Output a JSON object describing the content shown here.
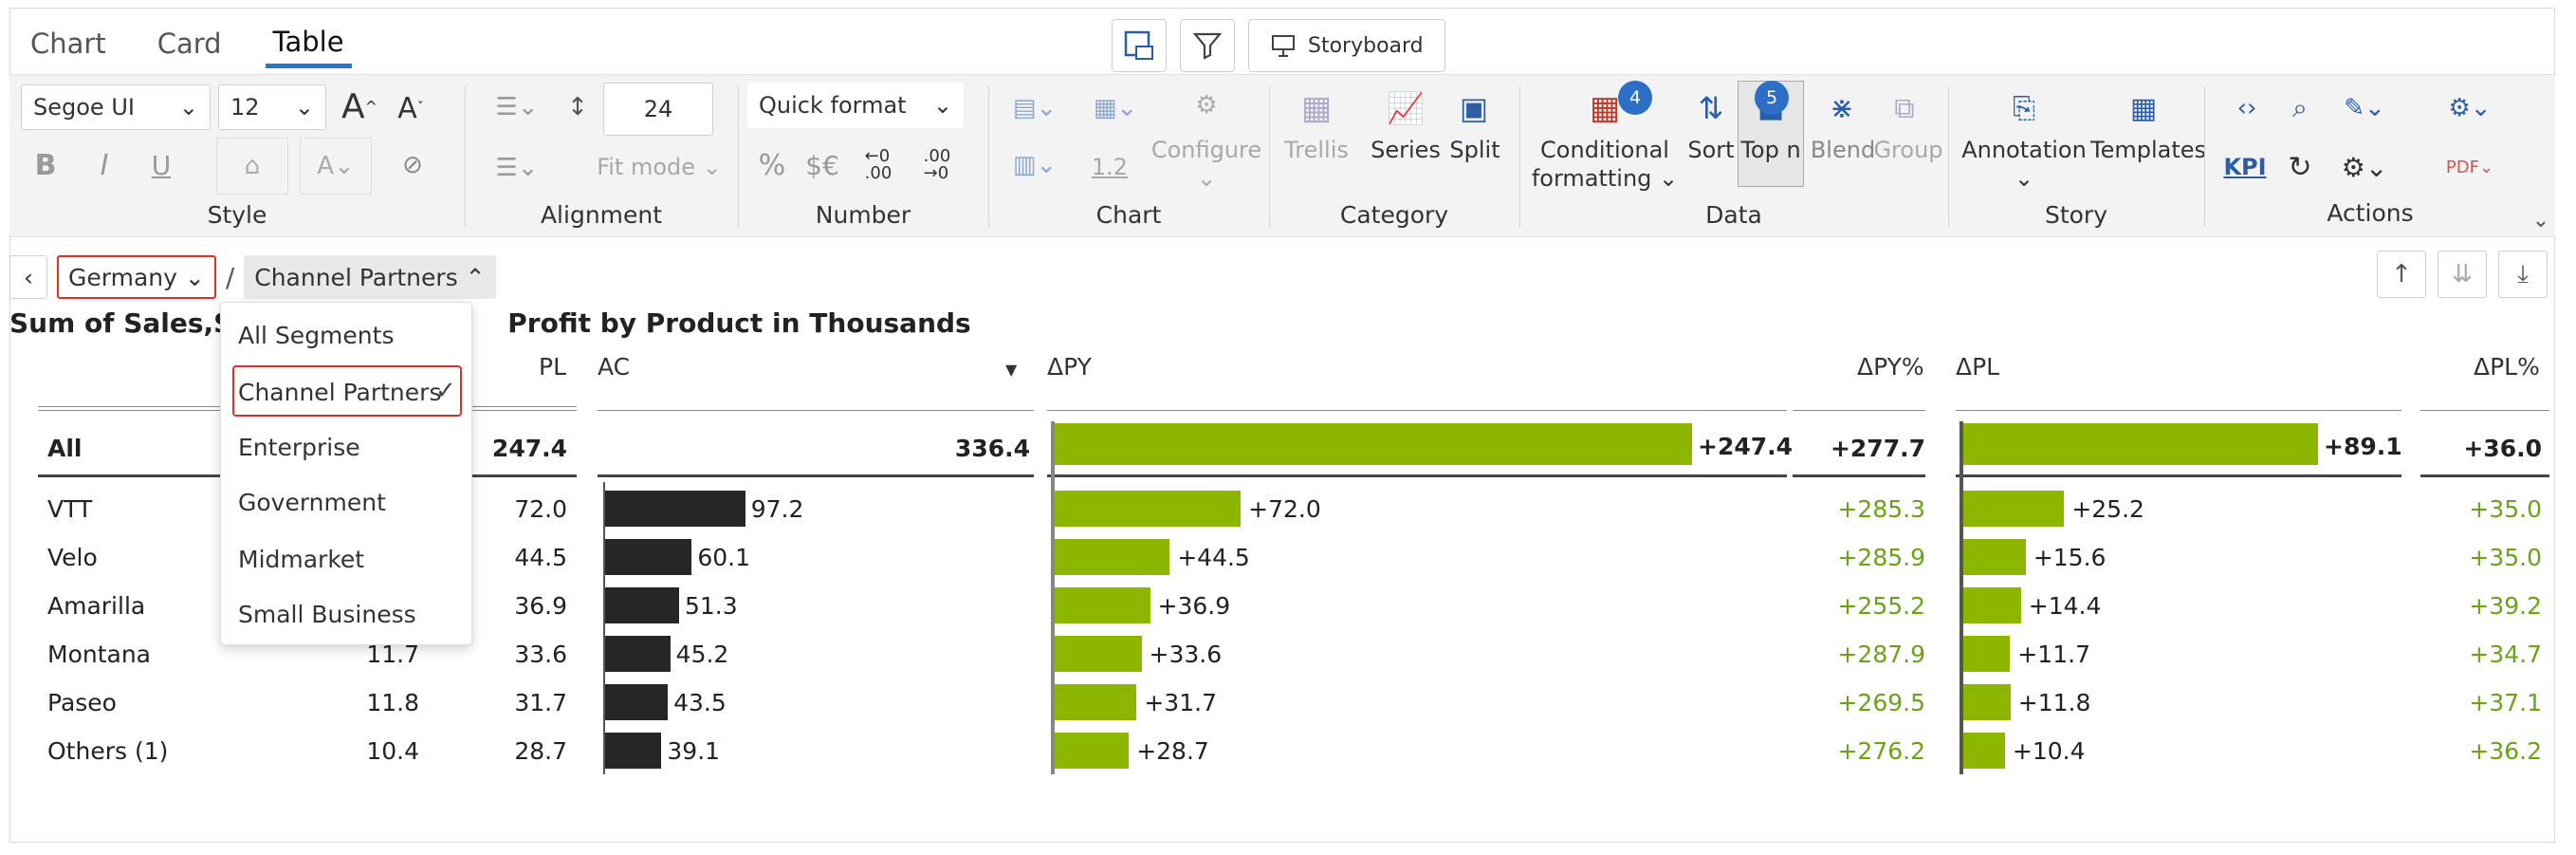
{
  "tabs": [
    {
      "label": "Chart"
    },
    {
      "label": "Card"
    },
    {
      "label": "Table"
    }
  ],
  "storyboard_label": "Storyboard",
  "ribbon": {
    "style": {
      "label": "Style",
      "font": "Segoe UI",
      "size": "12"
    },
    "alignment": {
      "label": "Alignment",
      "row_height": "24",
      "fit_mode": "Fit mode"
    },
    "number": {
      "label": "Number",
      "quick_format": "Quick format",
      "decimal": "1.2"
    },
    "chart": {
      "label": "Chart",
      "configure": "Configure"
    },
    "category": {
      "label": "Category",
      "trellis": "Trellis",
      "series": "Series",
      "split": "Split"
    },
    "data": {
      "label": "Data",
      "conditional_formatting_1": "Conditional",
      "conditional_formatting_2": "formatting",
      "cf_badge": "4",
      "sort": "Sort",
      "topn": "Top n",
      "topn_badge": "5",
      "blend": "Blend",
      "group": "Group"
    },
    "story": {
      "label": "Story",
      "annotation": "Annotation",
      "templates": "Templates"
    },
    "actions": {
      "label": "Actions",
      "kpi": "KPI"
    }
  },
  "breadcrumb": {
    "country": "Germany",
    "separator": "/",
    "segment": "Channel Partners"
  },
  "title": "Sum of Sales,Sum of Sales,Sum of Profit by Product in Thousands",
  "title_visible_left": "Sum of Sales,Su",
  "title_visible_right": "Profit by Product in Thousands",
  "dropdown": {
    "items": [
      "All Segments",
      "Channel Partners",
      "Enterprise",
      "Government",
      "Midmarket",
      "Small Business"
    ],
    "selected": "Channel Partners"
  },
  "headers": {
    "pl": "PL",
    "ac": "AC",
    "dpy": "ΔPY",
    "dpy_pct": "ΔPY%",
    "dpl": "ΔPL",
    "dpl_pct": "ΔPL%"
  },
  "colors": {
    "accent": "#2b76c8",
    "green": "#8db600",
    "bar_dark": "#262626",
    "red_outline": "#d9342b",
    "green_text": "#6aa318"
  },
  "table": {
    "total": {
      "label": "All",
      "pl": "247.4",
      "ac": "336.4",
      "dpy": "+247.4",
      "dpy_pct": "+277.7",
      "dpl": "+89.1",
      "dpl_pct": "+36.0",
      "ac_v": 336.4,
      "dpy_v": 247.4,
      "dpl_v": 89.1
    },
    "rows": [
      {
        "label": "VTT",
        "py": "",
        "pl": "72.0",
        "ac": "97.2",
        "dpy": "+72.0",
        "dpy_pct": "+285.3",
        "dpl": "+25.2",
        "dpl_pct": "+35.0",
        "ac_v": 97.2,
        "dpy_v": 72.0,
        "dpl_v": 25.2
      },
      {
        "label": "Velo",
        "py": "",
        "pl": "44.5",
        "ac": "60.1",
        "dpy": "+44.5",
        "dpy_pct": "+285.9",
        "dpl": "+15.6",
        "dpl_pct": "+35.0",
        "ac_v": 60.1,
        "dpy_v": 44.5,
        "dpl_v": 15.6
      },
      {
        "label": "Amarilla",
        "py": "",
        "pl": "36.9",
        "ac": "51.3",
        "dpy": "+36.9",
        "dpy_pct": "+255.2",
        "dpl": "+14.4",
        "dpl_pct": "+39.2",
        "ac_v": 51.3,
        "dpy_v": 36.9,
        "dpl_v": 14.4
      },
      {
        "label": "Montana",
        "py": "11.7",
        "pl": "33.6",
        "ac": "45.2",
        "dpy": "+33.6",
        "dpy_pct": "+287.9",
        "dpl": "+11.7",
        "dpl_pct": "+34.7",
        "ac_v": 45.2,
        "dpy_v": 33.6,
        "dpl_v": 11.7
      },
      {
        "label": "Paseo",
        "py": "11.8",
        "pl": "31.7",
        "ac": "43.5",
        "dpy": "+31.7",
        "dpy_pct": "+269.5",
        "dpl": "+11.8",
        "dpl_pct": "+37.1",
        "ac_v": 43.5,
        "dpy_v": 31.7,
        "dpl_v": 11.8
      },
      {
        "label": "Others (1)",
        "py": "10.4",
        "pl": "28.7",
        "ac": "39.1",
        "dpy": "+28.7",
        "dpy_pct": "+276.2",
        "dpl": "+10.4",
        "dpl_pct": "+36.2",
        "ac_v": 39.1,
        "dpy_v": 28.7,
        "dpl_v": 10.4
      }
    ]
  }
}
